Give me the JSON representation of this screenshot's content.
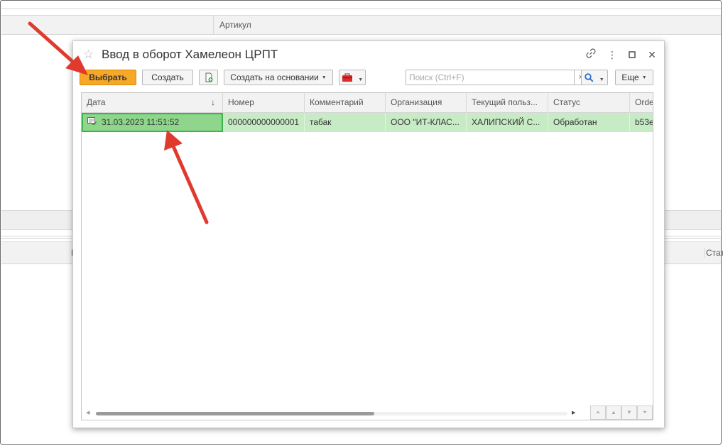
{
  "background": {
    "header_column": "Артикул",
    "lower_header_left": "Н",
    "lower_header_right": "Стат"
  },
  "dialog": {
    "title": "Ввод в оборот Хамелеон ЦРПТ",
    "toolbar": {
      "select_label": "Выбрать",
      "create_label": "Создать",
      "create_based_label": "Создать на основании",
      "more_label": "Еще",
      "search_placeholder": "Поиск (Ctrl+F)",
      "search_clear": "×"
    },
    "table": {
      "columns": [
        "Дата",
        "Номер",
        "Комментарий",
        "Организация",
        "Текущий польз...",
        "Статус",
        "Orde"
      ],
      "sort_indicator": "↓",
      "rows": [
        {
          "date": "31.03.2023 11:51:52",
          "number": "000000000000001",
          "comment": "табак",
          "organization": "ООО \"ИТ-КЛАС...",
          "user": "ХАЛИПСКИЙ С...",
          "status": "Обработан",
          "order": "b53e"
        }
      ]
    }
  },
  "colors": {
    "accent": "#f7a826",
    "selected_row": "#c7ebc4",
    "selected_cell": "#8fd68c",
    "annotation_arrow": "#e03a2f"
  },
  "icons": {
    "favorite": "star-icon",
    "link": "link-icon",
    "more": "more-vertical-icon",
    "maximize": "maximize-icon",
    "close": "close-icon",
    "add_copy": "add-document-icon",
    "tools": "toolbox-icon",
    "search": "search-icon"
  }
}
